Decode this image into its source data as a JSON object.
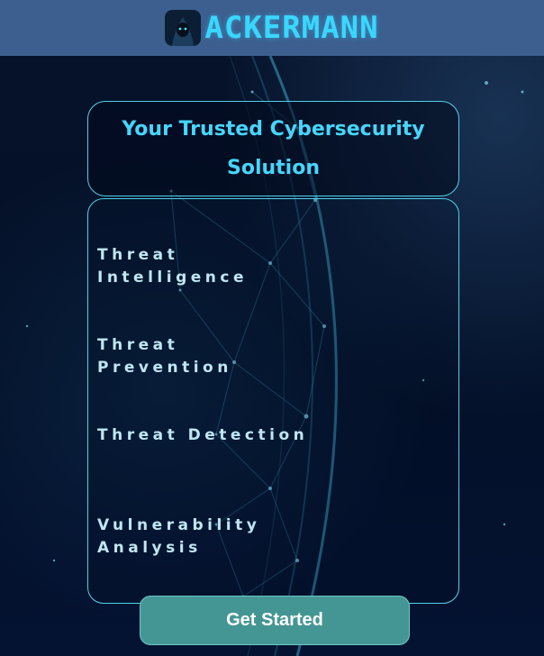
{
  "header": {
    "brand": "ACKERMANN",
    "logo_icon": "hooded-hacker-icon",
    "background_color": "#3c5f8f",
    "brand_color": "#39d7ff"
  },
  "hero": {
    "title": "Your Trusted Cybersecurity Solution"
  },
  "services": [
    {
      "label": "Threat Intelligence"
    },
    {
      "label": "Threat Prevention"
    },
    {
      "label": "Threat Detection"
    },
    {
      "label": "Vulnerability Analysis"
    }
  ],
  "cta": {
    "label": "Get Started",
    "color": "#449694"
  }
}
